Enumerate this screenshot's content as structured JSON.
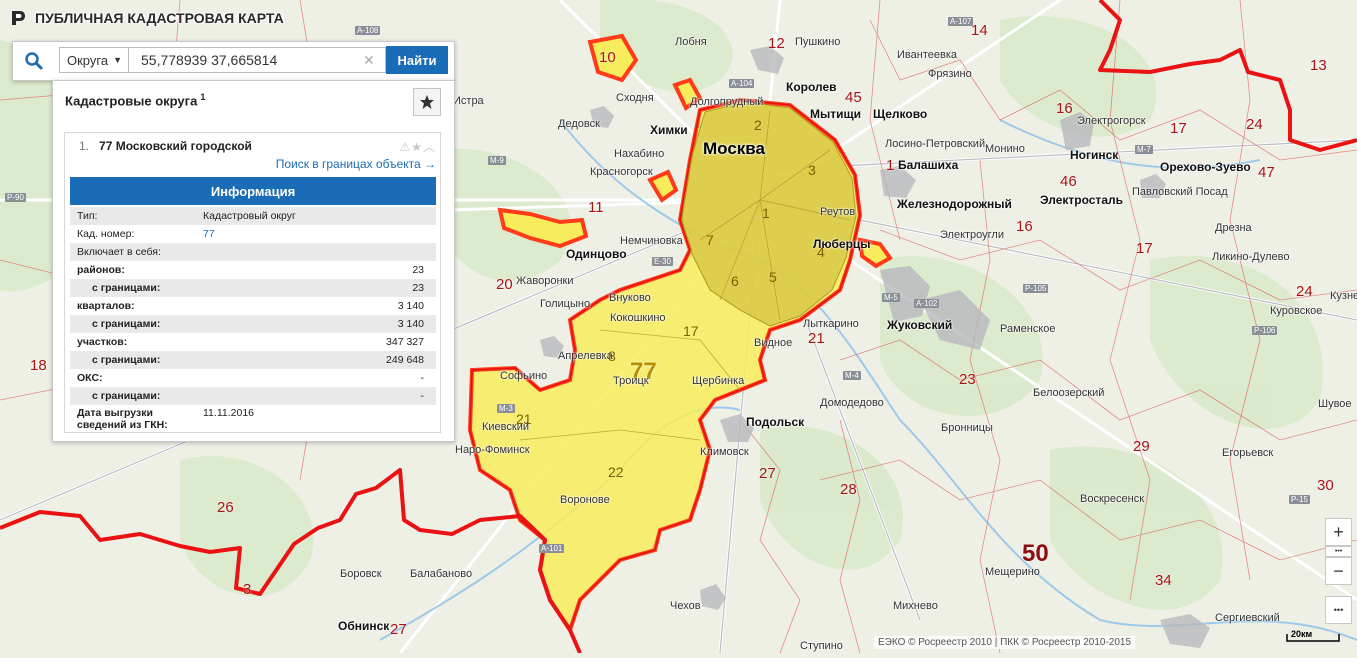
{
  "app": {
    "title": "ПУБЛИЧНАЯ КАДАСТРОВАЯ КАРТА"
  },
  "search": {
    "type_label": "Округа",
    "value": "55,778939 37,665814",
    "button_label": "Найти"
  },
  "panel": {
    "title": "Кадастровые округа",
    "count": "1",
    "result": {
      "index": "1.",
      "name": "77 Московский городской",
      "search_link": "Поиск в границах объекта →"
    },
    "info_title": "Информация",
    "rows": [
      {
        "key": "Тип:",
        "value": "Кадастровый округ"
      },
      {
        "key": "Кад. номер:",
        "value": "77"
      },
      {
        "key": "Включает в себя:",
        "value": ""
      },
      {
        "key": "районов:",
        "value": "23"
      },
      {
        "key": "с границами:",
        "value": "23"
      },
      {
        "key": "кварталов:",
        "value": "3 140"
      },
      {
        "key": "с границами:",
        "value": "3 140"
      },
      {
        "key": "участков:",
        "value": "347 327"
      },
      {
        "key": "с границами:",
        "value": "249 648"
      },
      {
        "key": "ОКС:",
        "value": "-"
      },
      {
        "key": "с границами:",
        "value": "-"
      },
      {
        "key": "Дата выгрузки сведений из ГКН:",
        "value": "11.11.2016"
      }
    ]
  },
  "map": {
    "moscow": "Москва",
    "moscow_district_label": "77",
    "cities": [
      "Королев",
      "Мытищи",
      "Щелково",
      "Химки",
      "Балашиха",
      "Железнодорожный",
      "Ногинск",
      "Электросталь",
      "Орехово-Зуево",
      "Люберцы",
      "Реутов",
      "Одинцово",
      "Жуковский",
      "Подольск",
      "Троицк",
      "Щербинка",
      "Обнинск",
      "Дедовск",
      "Красногорск",
      "Долгопрудный",
      "Внуково",
      "Видное",
      "Раменское",
      "Бронницы",
      "Домодедово",
      "Воскресенск",
      "Апрелевка",
      "Наро-Фоминск",
      "Пушкино",
      "Ивантеевка",
      "Фрязино",
      "Лобня",
      "Истра",
      "Лыткарино",
      "Электроугли",
      "Павловский Посад",
      "Дрезна",
      "Кокошкино",
      "Киевский",
      "Климовск",
      "Лосино-Петровский",
      "Чехов",
      "Михнево",
      "Мещерино",
      "Сергиевский",
      "Боровск",
      "Балабаново",
      "Жаворонки",
      "Голицыно",
      "Немчиновка",
      "Нахабино",
      "Сходня",
      "Монино",
      "Электрогорск",
      "Ликино-Дулево",
      "Куровское",
      "Шувое",
      "Егорьевск",
      "Белоозерский",
      "Софьино",
      "Воронове",
      "Кузнецы",
      "Ступино"
    ],
    "districts": [
      "14",
      "12",
      "45",
      "16",
      "17",
      "24",
      "13",
      "10",
      "46",
      "47",
      "1",
      "3",
      "2",
      "7",
      "6",
      "5",
      "4",
      "20",
      "11",
      "16",
      "17",
      "18",
      "26",
      "3",
      "27",
      "28",
      "21",
      "22",
      "23",
      "29",
      "30",
      "34",
      "50",
      "12",
      "17"
    ],
    "roads": [
      "М-9",
      "М-7",
      "М-4",
      "М-5",
      "М-3",
      "А-107",
      "А-108",
      "А-101",
      "А-102",
      "А-104",
      "Р-105",
      "Р-90",
      "Е-30",
      "Р-106",
      "Р-15"
    ],
    "inner_numbers": [
      "1",
      "2",
      "3",
      "4",
      "5",
      "6",
      "7",
      "8",
      "17",
      "21",
      "22"
    ]
  },
  "footer": {
    "attribution": "ЕЭКО © Росреестр 2010 | ПКК © Росреестр 2010-2015",
    "scale": "20км"
  },
  "controls": {
    "zoom_in": "+",
    "zoom_out": "−",
    "more": "•••"
  },
  "colors": {
    "accent": "#1b6cb6",
    "boundary": "#e8140e",
    "highlight": "#f5e34a"
  }
}
